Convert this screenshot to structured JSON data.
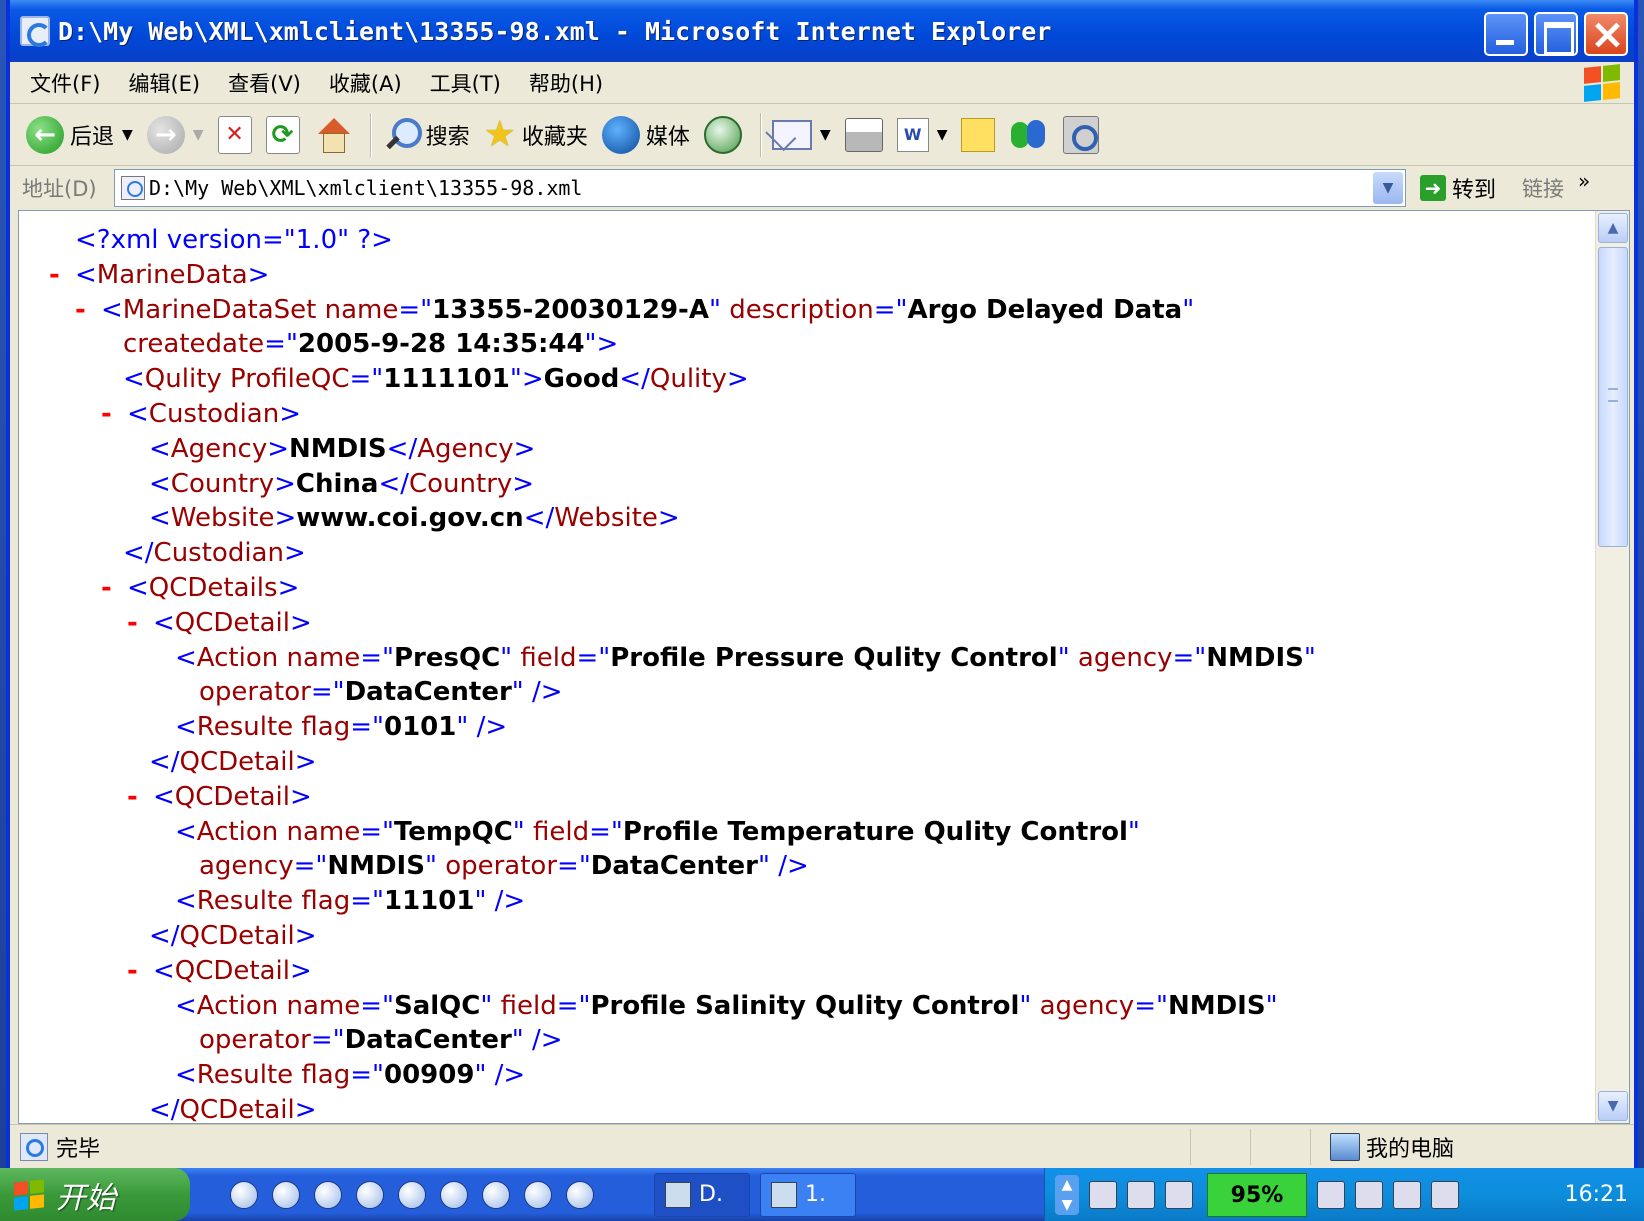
{
  "window": {
    "title": "D:\\My Web\\XML\\xmlclient\\13355-98.xml - Microsoft Internet Explorer"
  },
  "menu": [
    "文件(F)",
    "编辑(E)",
    "查看(V)",
    "收藏(A)",
    "工具(T)",
    "帮助(H)"
  ],
  "toolbar": {
    "back_label": "后退",
    "search_label": "搜索",
    "favorites_label": "收藏夹",
    "media_label": "媒体",
    "word_label": "W"
  },
  "address": {
    "label": "地址(D)",
    "value": "D:\\My Web\\XML\\xmlclient\\13355-98.xml",
    "go_label": "转到",
    "links_label": "链接",
    "more": "»"
  },
  "xml": {
    "pi": "<?xml version=\"1.0\" ?>",
    "dataset_name": "13355-20030129-A",
    "dataset_description": "Argo Delayed Data",
    "dataset_createdate": "2005-9-28 14:35:44",
    "qulity_profileqc": "1111101",
    "qulity_text": "Good",
    "agency": "NMDIS",
    "country": "China",
    "website": "www.coi.gov.cn",
    "details": [
      {
        "name": "PresQC",
        "field": "Profile Pressure Qulity Control",
        "agency": "NMDIS",
        "operator": "DataCenter",
        "flag": "0101"
      },
      {
        "name": "TempQC",
        "field": "Profile Temperature Qulity Control",
        "agency": "NMDIS",
        "operator": "DataCenter",
        "flag": "11101"
      },
      {
        "name": "SalQC",
        "field": "Profile Salinity Qulity Control",
        "agency": "NMDIS",
        "operator": "DataCenter",
        "flag": "00909"
      }
    ]
  },
  "status": {
    "text": "完毕",
    "zone": "我的电脑"
  },
  "taskbar": {
    "start_label": "开始",
    "task1": "D.",
    "task2": "1.",
    "battery": "95%",
    "clock": "16:21"
  }
}
